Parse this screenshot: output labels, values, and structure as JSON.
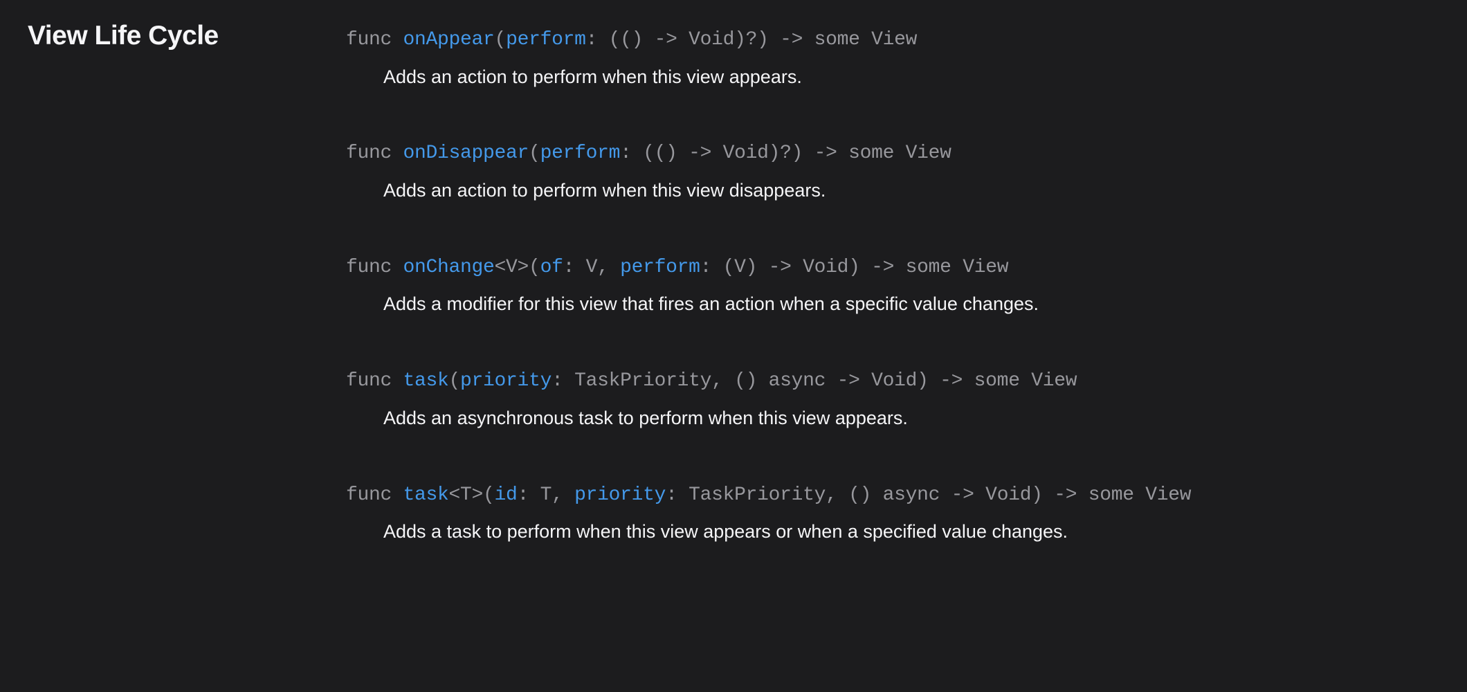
{
  "section": {
    "title": "View Life Cycle"
  },
  "entries": [
    {
      "sig": {
        "kw1": "func ",
        "fn": "onAppear",
        "paren1": "(",
        "param1": "perform",
        "rest": ": (() -> Void)?) -> some View"
      },
      "desc": "Adds an action to perform when this view appears."
    },
    {
      "sig": {
        "kw1": "func ",
        "fn": "onDisappear",
        "paren1": "(",
        "param1": "perform",
        "rest": ": (() -> Void)?) -> some View"
      },
      "desc": "Adds an action to perform when this view disappears."
    },
    {
      "sig": {
        "kw1": "func ",
        "fn": "onChange",
        "generic": "<V>(",
        "param1": "of",
        "mid1": ": V, ",
        "param2": "perform",
        "rest": ": (V) -> Void) -> some View"
      },
      "desc": "Adds a modifier for this view that fires an action when a specific value changes."
    },
    {
      "sig": {
        "kw1": "func ",
        "fn": "task",
        "paren1": "(",
        "param1": "priority",
        "rest": ": TaskPriority, () async -> Void) -> some View"
      },
      "desc": "Adds an asynchronous task to perform when this view appears."
    },
    {
      "sig": {
        "kw1": "func ",
        "fn": "task",
        "generic": "<T>(",
        "param1": "id",
        "mid1": ": T, ",
        "param2": "priority",
        "rest": ": TaskPriority, () async -> Void) -> some View"
      },
      "desc": "Adds a task to perform when this view appears or when a specified value changes."
    }
  ]
}
